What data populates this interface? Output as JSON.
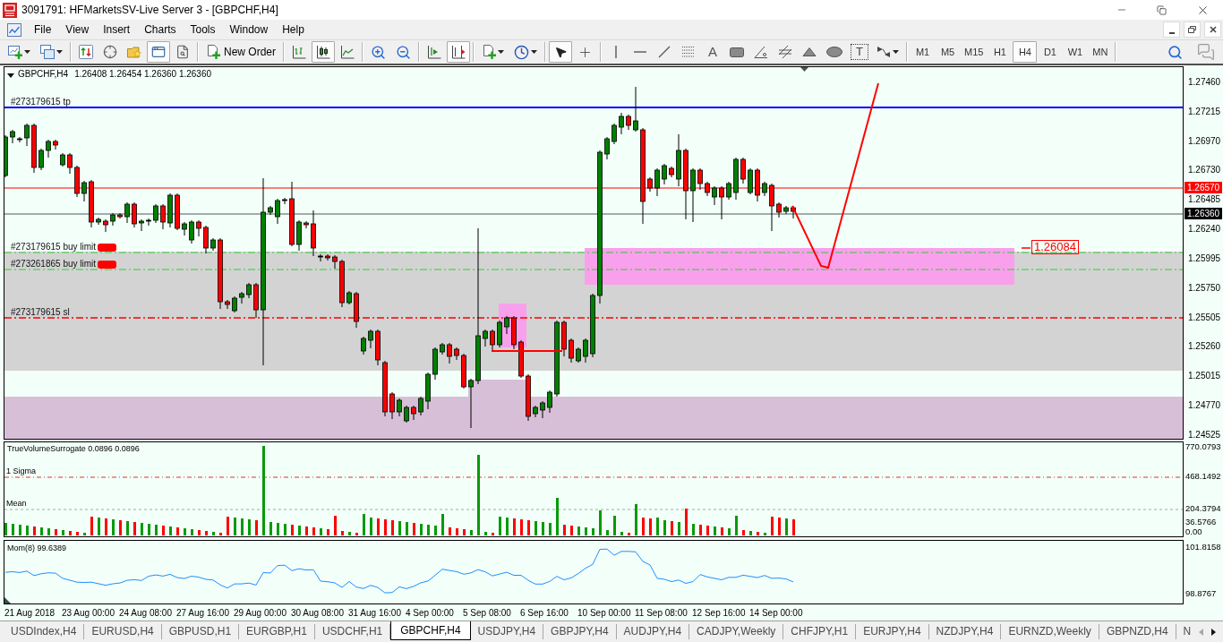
{
  "window": {
    "title": "3091791: HFMarketsSV-Live Server 3 - [GBPCHF,H4]"
  },
  "menu": [
    "File",
    "View",
    "Insert",
    "Charts",
    "Tools",
    "Window",
    "Help"
  ],
  "toolbar": [
    [
      {
        "kind": "new-chart",
        "dropdown": true,
        "pressed": false
      },
      {
        "kind": "profiles",
        "dropdown": true,
        "pressed": false
      }
    ],
    [
      {
        "kind": "market-watch",
        "pressed": false
      },
      {
        "kind": "data-window",
        "pressed": false
      },
      {
        "kind": "navigator",
        "pressed": false
      },
      {
        "kind": "terminal",
        "pressed": true
      },
      {
        "kind": "tester",
        "pressed": false
      }
    ],
    [
      {
        "kind": "new-order",
        "label": "New Order",
        "pressed": false
      }
    ],
    [
      {
        "kind": "bar-chart",
        "pressed": false
      },
      {
        "kind": "candle-chart",
        "pressed": true
      },
      {
        "kind": "line-chart",
        "pressed": false
      }
    ],
    [
      {
        "kind": "zoom-in",
        "pressed": false
      },
      {
        "kind": "zoom-out",
        "pressed": false
      }
    ],
    [
      {
        "kind": "auto-scroll",
        "pressed": false
      },
      {
        "kind": "chart-shift",
        "pressed": true
      }
    ],
    [
      {
        "kind": "templates",
        "dropdown": true,
        "pressed": false
      },
      {
        "kind": "periods",
        "dropdown": true,
        "pressed": false
      }
    ],
    [
      {
        "kind": "cursor",
        "pressed": true
      },
      {
        "kind": "crosshair",
        "pressed": false
      }
    ],
    [
      {
        "kind": "vertical-line",
        "pressed": false
      },
      {
        "kind": "horizontal-line",
        "pressed": false
      },
      {
        "kind": "trendline",
        "pressed": false
      },
      {
        "kind": "fibonacci",
        "pressed": false
      },
      {
        "kind": "text",
        "label": "A",
        "pressed": false
      },
      {
        "kind": "rectangle",
        "pressed": false
      },
      {
        "kind": "angle",
        "pressed": false
      },
      {
        "kind": "channel",
        "pressed": false
      },
      {
        "kind": "triangle",
        "pressed": false
      },
      {
        "kind": "ellipse",
        "pressed": false
      },
      {
        "kind": "text-label",
        "label": "T",
        "pressed": false
      },
      {
        "kind": "arrows",
        "dropdown": true,
        "pressed": false
      }
    ],
    [
      {
        "kind": "timeframe",
        "label": "M1",
        "selected": false
      },
      {
        "kind": "timeframe",
        "label": "M5",
        "selected": false
      },
      {
        "kind": "timeframe",
        "label": "M15",
        "selected": false
      },
      {
        "kind": "timeframe",
        "label": "H1",
        "selected": false
      },
      {
        "kind": "timeframe",
        "label": "H4",
        "selected": true
      },
      {
        "kind": "timeframe",
        "label": "D1",
        "selected": false
      },
      {
        "kind": "timeframe",
        "label": "W1",
        "selected": false
      },
      {
        "kind": "timeframe",
        "label": "MN",
        "selected": false
      }
    ],
    [
      {
        "kind": "search",
        "pressed": false
      },
      {
        "kind": "chat",
        "pressed": false
      }
    ]
  ],
  "chart": {
    "header": {
      "symbol": "GBPCHF,H4",
      "quotes": "1.26408 1.26454 1.26360 1.26360"
    },
    "order_lines": [
      {
        "kind": "tp",
        "label": "#273179615 tp"
      },
      {
        "kind": "buy-limit",
        "label": "#273179615 buy limit"
      },
      {
        "kind": "buy-limit",
        "label": "#273261865 buy limit"
      },
      {
        "kind": "sl",
        "label": "#273179615 sl"
      }
    ],
    "price_tags": [
      {
        "kind": "line",
        "text": "1.26570"
      },
      {
        "kind": "bid",
        "text": "1.26360"
      }
    ],
    "drawn_price_label": "1.26084",
    "price_axis": [
      "1.27460",
      "1.27215",
      "1.26970",
      "1.26730",
      "1.26485",
      "1.26240",
      "1.25995",
      "1.25750",
      "1.25505",
      "1.25260",
      "1.25015",
      "1.24770",
      "1.24525"
    ]
  },
  "volume": {
    "title": "TrueVolumeSurrogate 0.0896 0.0896",
    "levels": [
      {
        "kind": "sigma",
        "label": "1 Sigma"
      },
      {
        "kind": "mean",
        "label": "Mean"
      }
    ],
    "axis": [
      "770.0793",
      "468.1492",
      "204.3794",
      "36.5766",
      "0.00"
    ]
  },
  "momentum": {
    "title": "Mom(8) 99.6389",
    "axis": [
      "101.8158",
      "98.8767"
    ]
  },
  "time_axis": [
    "21 Aug 2018",
    "23 Aug 00:00",
    "24 Aug 08:00",
    "27 Aug 16:00",
    "29 Aug 00:00",
    "30 Aug 08:00",
    "31 Aug 16:00",
    "4 Sep 00:00",
    "5 Sep 08:00",
    "6 Sep 16:00",
    "10 Sep 00:00",
    "11 Sep 08:00",
    "12 Sep 16:00",
    "14 Sep 00:00"
  ],
  "tabs": [
    {
      "label": "USDIndex,H4",
      "selected": false
    },
    {
      "label": "EURUSD,H4",
      "selected": false
    },
    {
      "label": "GBPUSD,H1",
      "selected": false
    },
    {
      "label": "EURGBP,H1",
      "selected": false
    },
    {
      "label": "USDCHF,H1",
      "selected": false
    },
    {
      "label": "GBPCHF,H4",
      "selected": true
    },
    {
      "label": "USDJPY,H4",
      "selected": false
    },
    {
      "label": "GBPJPY,H4",
      "selected": false
    },
    {
      "label": "AUDJPY,H4",
      "selected": false
    },
    {
      "label": "CADJPY,Weekly",
      "selected": false
    },
    {
      "label": "CHFJPY,H1",
      "selected": false
    },
    {
      "label": "EURJPY,H4",
      "selected": false
    },
    {
      "label": "NZDJPY,H4",
      "selected": false
    },
    {
      "label": "EURNZD,Weekly",
      "selected": false
    },
    {
      "label": "GBPNZD,H4",
      "selected": false
    },
    {
      "label": "N",
      "selected": false
    }
  ],
  "tab_scroll": {
    "back_enabled": false,
    "forward_enabled": true
  }
}
